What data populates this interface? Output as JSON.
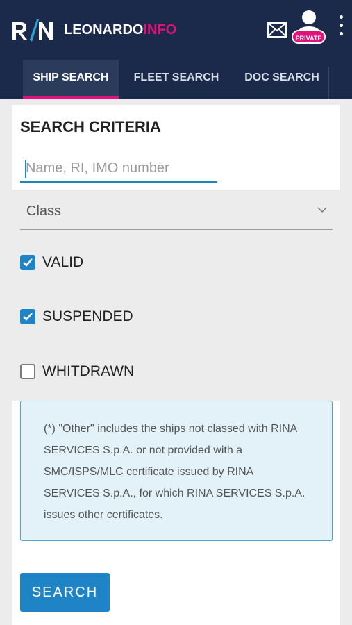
{
  "header": {
    "logo_text": "RINA",
    "brand_main": "LEONARDO",
    "brand_accent": "INFO",
    "private_badge": "PRIVATE",
    "icons": [
      "rina-logo-icon",
      "mail-icon",
      "user-avatar-icon",
      "kebab-menu-icon"
    ],
    "colors": {
      "navy": "#1b2a4a",
      "magenta": "#e0137a",
      "blue": "#1f84c6"
    }
  },
  "tabs": [
    {
      "label": "SHIP SEARCH",
      "active": true
    },
    {
      "label": "FLEET SEARCH",
      "active": false
    },
    {
      "label": "DOC SEARCH",
      "active": false
    }
  ],
  "search": {
    "title": "SEARCH CRITERIA",
    "placeholder": "Name, RI, IMO number",
    "value": "",
    "class_select": {
      "label": "Class"
    },
    "filters": [
      {
        "label": "VALID",
        "checked": true
      },
      {
        "label": "SUSPENDED",
        "checked": true
      },
      {
        "label": "WHITDRAWN",
        "checked": false
      }
    ],
    "note": "(*) \"Other\" includes the ships not classed with RINA SERVICES S.p.A. or not provided with a SMC/ISPS/MLC certificate issued by RINA SERVICES S.p.A., for which RINA SERVICES S.p.A. issues other certificates.",
    "button_label": "SEARCH"
  }
}
